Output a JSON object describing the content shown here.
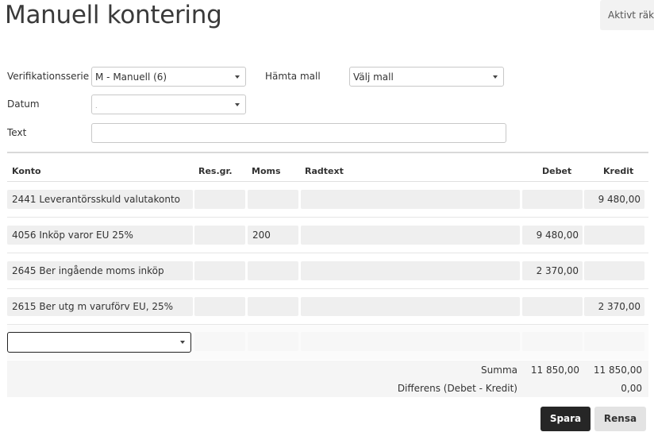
{
  "page": {
    "title": "Manuell kontering",
    "fiscal_year_button": "Aktivt räke"
  },
  "form": {
    "series_label": "Verifikationsserie",
    "series_value": "M - Manuell (6)",
    "template_label": "Hämta mall",
    "template_value": "Välj mall",
    "date_label": "Datum",
    "date_value": ".",
    "text_label": "Text",
    "text_value": ""
  },
  "table": {
    "headers": {
      "account": "Konto",
      "resgr": "Res.gr.",
      "vat": "Moms",
      "rowtext": "Radtext",
      "debit": "Debet",
      "credit": "Kredit"
    },
    "rows": [
      {
        "account": "2441 Leverantörsskuld valutakonto",
        "resgr": "",
        "vat": "",
        "rowtext": "",
        "debit": "",
        "credit": "9 480,00"
      },
      {
        "account": "4056 Inköp varor EU 25%",
        "resgr": "",
        "vat": "200",
        "rowtext": "",
        "debit": "9 480,00",
        "credit": ""
      },
      {
        "account": "2645 Ber ingående moms inköp",
        "resgr": "",
        "vat": "",
        "rowtext": "",
        "debit": "2 370,00",
        "credit": ""
      },
      {
        "account": "2615 Ber utg m varuförv EU, 25%",
        "resgr": "",
        "vat": "",
        "rowtext": "",
        "debit": "",
        "credit": "2 370,00"
      }
    ]
  },
  "summary": {
    "sum_label": "Summa",
    "sum_debit": "11 850,00",
    "sum_credit": "11 850,00",
    "diff_label": "Differens (Debet - Kredit)",
    "diff_value": "0,00"
  },
  "actions": {
    "save": "Spara",
    "reset": "Rensa"
  }
}
